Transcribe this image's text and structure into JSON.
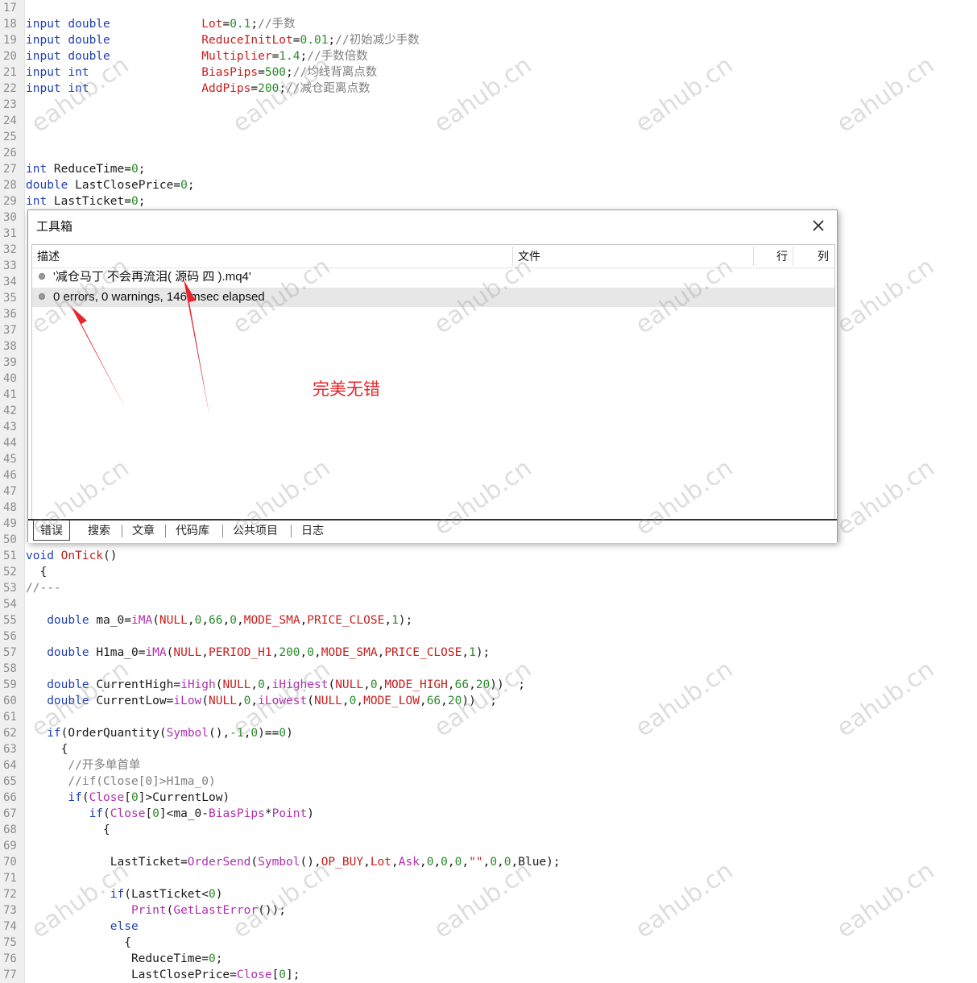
{
  "editor": {
    "lines": [
      {
        "n": "17",
        "t": []
      },
      {
        "n": "18",
        "t": [
          [
            "kw",
            "input double"
          ],
          [
            "tx",
            "             "
          ],
          [
            "cst",
            "Lot"
          ],
          [
            "tx",
            "="
          ],
          [
            "num",
            "0.1"
          ],
          [
            "tx",
            ";"
          ],
          [
            "cm",
            "//手数"
          ]
        ]
      },
      {
        "n": "19",
        "t": [
          [
            "kw",
            "input double"
          ],
          [
            "tx",
            "             "
          ],
          [
            "cst",
            "ReduceInitLot"
          ],
          [
            "tx",
            "="
          ],
          [
            "num",
            "0.01"
          ],
          [
            "tx",
            ";"
          ],
          [
            "cm",
            "//初始减少手数"
          ]
        ]
      },
      {
        "n": "20",
        "t": [
          [
            "kw",
            "input double"
          ],
          [
            "tx",
            "             "
          ],
          [
            "cst",
            "Multiplier"
          ],
          [
            "tx",
            "="
          ],
          [
            "num",
            "1.4"
          ],
          [
            "tx",
            ";"
          ],
          [
            "cm",
            "//手数倍数"
          ]
        ]
      },
      {
        "n": "21",
        "t": [
          [
            "kw",
            "input int"
          ],
          [
            "tx",
            "                "
          ],
          [
            "cst",
            "BiasPips"
          ],
          [
            "tx",
            "="
          ],
          [
            "num",
            "500"
          ],
          [
            "tx",
            ";"
          ],
          [
            "cm",
            "//均线背离点数"
          ]
        ]
      },
      {
        "n": "22",
        "t": [
          [
            "kw",
            "input int"
          ],
          [
            "tx",
            "                "
          ],
          [
            "cst",
            "AddPips"
          ],
          [
            "tx",
            "="
          ],
          [
            "num",
            "200"
          ],
          [
            "tx",
            ";"
          ],
          [
            "cm",
            "//减仓距离点数"
          ]
        ]
      },
      {
        "n": "23",
        "t": []
      },
      {
        "n": "24",
        "t": []
      },
      {
        "n": "25",
        "t": []
      },
      {
        "n": "26",
        "t": []
      },
      {
        "n": "27",
        "t": [
          [
            "kw",
            "int"
          ],
          [
            "tx",
            " ReduceTime="
          ],
          [
            "num",
            "0"
          ],
          [
            "tx",
            ";"
          ]
        ]
      },
      {
        "n": "28",
        "t": [
          [
            "kw",
            "double"
          ],
          [
            "tx",
            " LastClosePrice="
          ],
          [
            "num",
            "0"
          ],
          [
            "tx",
            ";"
          ]
        ]
      },
      {
        "n": "29",
        "t": [
          [
            "kw",
            "int"
          ],
          [
            "tx",
            " LastTicket="
          ],
          [
            "num",
            "0"
          ],
          [
            "tx",
            ";"
          ]
        ]
      },
      {
        "n": "30",
        "t": []
      },
      {
        "n": "31",
        "t": []
      },
      {
        "n": "32",
        "t": []
      },
      {
        "n": "33",
        "t": []
      },
      {
        "n": "34",
        "t": []
      },
      {
        "n": "35",
        "t": []
      },
      {
        "n": "36",
        "t": []
      },
      {
        "n": "37",
        "t": []
      },
      {
        "n": "38",
        "t": []
      },
      {
        "n": "39",
        "t": []
      },
      {
        "n": "40",
        "t": []
      },
      {
        "n": "41",
        "t": []
      },
      {
        "n": "42",
        "t": []
      },
      {
        "n": "43",
        "t": []
      },
      {
        "n": "44",
        "t": []
      },
      {
        "n": "45",
        "t": []
      },
      {
        "n": "46",
        "t": []
      },
      {
        "n": "47",
        "t": []
      },
      {
        "n": "48",
        "t": []
      },
      {
        "n": "49",
        "t": []
      },
      {
        "n": "50",
        "t": []
      },
      {
        "n": "51",
        "t": [
          [
            "kw",
            "void"
          ],
          [
            "tx",
            " "
          ],
          [
            "cst",
            "OnTick"
          ],
          [
            "tx",
            "()"
          ]
        ]
      },
      {
        "n": "52",
        "t": [
          [
            "tx",
            "  {"
          ]
        ]
      },
      {
        "n": "53",
        "t": [
          [
            "cm",
            "//---"
          ]
        ]
      },
      {
        "n": "54",
        "t": []
      },
      {
        "n": "55",
        "t": [
          [
            "tx",
            "   "
          ],
          [
            "kw",
            "double"
          ],
          [
            "tx",
            " ma_0="
          ],
          [
            "fn",
            "iMA"
          ],
          [
            "tx",
            "("
          ],
          [
            "cst",
            "NULL"
          ],
          [
            "tx",
            ","
          ],
          [
            "num",
            "0"
          ],
          [
            "tx",
            ","
          ],
          [
            "num",
            "66"
          ],
          [
            "tx",
            ","
          ],
          [
            "num",
            "0"
          ],
          [
            "tx",
            ","
          ],
          [
            "cst",
            "MODE_SMA"
          ],
          [
            "tx",
            ","
          ],
          [
            "cst",
            "PRICE_CLOSE"
          ],
          [
            "tx",
            ","
          ],
          [
            "num",
            "1"
          ],
          [
            "tx",
            ");"
          ]
        ]
      },
      {
        "n": "56",
        "t": []
      },
      {
        "n": "57",
        "t": [
          [
            "tx",
            "   "
          ],
          [
            "kw",
            "double"
          ],
          [
            "tx",
            " H1ma_0="
          ],
          [
            "fn",
            "iMA"
          ],
          [
            "tx",
            "("
          ],
          [
            "cst",
            "NULL"
          ],
          [
            "tx",
            ","
          ],
          [
            "cst",
            "PERIOD_H1"
          ],
          [
            "tx",
            ","
          ],
          [
            "num",
            "200"
          ],
          [
            "tx",
            ","
          ],
          [
            "num",
            "0"
          ],
          [
            "tx",
            ","
          ],
          [
            "cst",
            "MODE_SMA"
          ],
          [
            "tx",
            ","
          ],
          [
            "cst",
            "PRICE_CLOSE"
          ],
          [
            "tx",
            ","
          ],
          [
            "num",
            "1"
          ],
          [
            "tx",
            ");"
          ]
        ]
      },
      {
        "n": "58",
        "t": []
      },
      {
        "n": "59",
        "t": [
          [
            "tx",
            "   "
          ],
          [
            "kw",
            "double"
          ],
          [
            "tx",
            " CurrentHigh="
          ],
          [
            "fn",
            "iHigh"
          ],
          [
            "tx",
            "("
          ],
          [
            "cst",
            "NULL"
          ],
          [
            "tx",
            ","
          ],
          [
            "num",
            "0"
          ],
          [
            "tx",
            ","
          ],
          [
            "fn",
            "iHighest"
          ],
          [
            "tx",
            "("
          ],
          [
            "cst",
            "NULL"
          ],
          [
            "tx",
            ","
          ],
          [
            "num",
            "0"
          ],
          [
            "tx",
            ","
          ],
          [
            "cst",
            "MODE_HIGH"
          ],
          [
            "tx",
            ","
          ],
          [
            "num",
            "66"
          ],
          [
            "tx",
            ","
          ],
          [
            "num",
            "20"
          ],
          [
            "tx",
            "))  ;"
          ]
        ]
      },
      {
        "n": "60",
        "t": [
          [
            "tx",
            "   "
          ],
          [
            "kw",
            "double"
          ],
          [
            "tx",
            " CurrentLow="
          ],
          [
            "fn",
            "iLow"
          ],
          [
            "tx",
            "("
          ],
          [
            "cst",
            "NULL"
          ],
          [
            "tx",
            ","
          ],
          [
            "num",
            "0"
          ],
          [
            "tx",
            ","
          ],
          [
            "fn",
            "iLowest"
          ],
          [
            "tx",
            "("
          ],
          [
            "cst",
            "NULL"
          ],
          [
            "tx",
            ","
          ],
          [
            "num",
            "0"
          ],
          [
            "tx",
            ","
          ],
          [
            "cst",
            "MODE_LOW"
          ],
          [
            "tx",
            ","
          ],
          [
            "num",
            "66"
          ],
          [
            "tx",
            ","
          ],
          [
            "num",
            "20"
          ],
          [
            "tx",
            "))  ;"
          ]
        ]
      },
      {
        "n": "61",
        "t": []
      },
      {
        "n": "62",
        "t": [
          [
            "tx",
            "   "
          ],
          [
            "kw",
            "if"
          ],
          [
            "tx",
            "(OrderQuantity("
          ],
          [
            "fn",
            "Symbol"
          ],
          [
            "tx",
            "(),"
          ],
          [
            "num",
            "-1"
          ],
          [
            "tx",
            ","
          ],
          [
            "num",
            "0"
          ],
          [
            "tx",
            ")=="
          ],
          [
            "num",
            "0"
          ],
          [
            "tx",
            ")"
          ]
        ]
      },
      {
        "n": "63",
        "t": [
          [
            "tx",
            "     {"
          ]
        ]
      },
      {
        "n": "64",
        "t": [
          [
            "tx",
            "      "
          ],
          [
            "cm",
            "//开多单首单"
          ]
        ]
      },
      {
        "n": "65",
        "t": [
          [
            "tx",
            "      "
          ],
          [
            "cm",
            "//if(Close[0]>H1ma_0)"
          ]
        ]
      },
      {
        "n": "66",
        "t": [
          [
            "tx",
            "      "
          ],
          [
            "kw",
            "if"
          ],
          [
            "tx",
            "("
          ],
          [
            "fn",
            "Close"
          ],
          [
            "tx",
            "["
          ],
          [
            "num",
            "0"
          ],
          [
            "tx",
            "]>CurrentLow)"
          ]
        ]
      },
      {
        "n": "67",
        "t": [
          [
            "tx",
            "         "
          ],
          [
            "kw",
            "if"
          ],
          [
            "tx",
            "("
          ],
          [
            "fn",
            "Close"
          ],
          [
            "tx",
            "["
          ],
          [
            "num",
            "0"
          ],
          [
            "tx",
            "]<ma_0-"
          ],
          [
            "fn",
            "BiasPips"
          ],
          [
            "tx",
            "*"
          ],
          [
            "fn",
            "Point"
          ],
          [
            "tx",
            ")"
          ]
        ]
      },
      {
        "n": "68",
        "t": [
          [
            "tx",
            "           {"
          ]
        ]
      },
      {
        "n": "69",
        "t": []
      },
      {
        "n": "70",
        "t": [
          [
            "tx",
            "            LastTicket="
          ],
          [
            "fn",
            "OrderSend"
          ],
          [
            "tx",
            "("
          ],
          [
            "fn",
            "Symbol"
          ],
          [
            "tx",
            "(),"
          ],
          [
            "cst",
            "OP_BUY"
          ],
          [
            "tx",
            ","
          ],
          [
            "cst",
            "Lot"
          ],
          [
            "tx",
            ","
          ],
          [
            "fn",
            "Ask"
          ],
          [
            "tx",
            ","
          ],
          [
            "num",
            "0"
          ],
          [
            "tx",
            ","
          ],
          [
            "num",
            "0"
          ],
          [
            "tx",
            ","
          ],
          [
            "num",
            "0"
          ],
          [
            "tx",
            ","
          ],
          [
            "cst",
            "\"\""
          ],
          [
            "tx",
            ","
          ],
          [
            "num",
            "0"
          ],
          [
            "tx",
            ","
          ],
          [
            "num",
            "0"
          ],
          [
            "tx",
            ",Blue);"
          ]
        ]
      },
      {
        "n": "71",
        "t": []
      },
      {
        "n": "72",
        "t": [
          [
            "tx",
            "            "
          ],
          [
            "kw",
            "if"
          ],
          [
            "tx",
            "(LastTicket<"
          ],
          [
            "num",
            "0"
          ],
          [
            "tx",
            ")"
          ]
        ]
      },
      {
        "n": "73",
        "t": [
          [
            "tx",
            "               "
          ],
          [
            "fn",
            "Print"
          ],
          [
            "tx",
            "("
          ],
          [
            "fn",
            "GetLastError"
          ],
          [
            "tx",
            "());"
          ]
        ]
      },
      {
        "n": "74",
        "t": [
          [
            "tx",
            "            "
          ],
          [
            "kw",
            "else"
          ]
        ]
      },
      {
        "n": "75",
        "t": [
          [
            "tx",
            "              {"
          ]
        ]
      },
      {
        "n": "76",
        "t": [
          [
            "tx",
            "               ReduceTime="
          ],
          [
            "num",
            "0"
          ],
          [
            "tx",
            ";"
          ]
        ]
      },
      {
        "n": "77",
        "t": [
          [
            "tx",
            "               LastClosePrice="
          ],
          [
            "fn",
            "Close"
          ],
          [
            "tx",
            "["
          ],
          [
            "num",
            "0"
          ],
          [
            "tx",
            "];"
          ]
        ]
      }
    ]
  },
  "toolbox": {
    "title": "工具箱",
    "columns": {
      "description": "描述",
      "file": "文件",
      "row": "行",
      "col": "列"
    },
    "rows": [
      {
        "text": "'减仓马丁 不会再流泪( 源码 四 ).mq4'",
        "selected": false
      },
      {
        "text": "0 errors, 0 warnings, 146 msec elapsed",
        "selected": true
      }
    ],
    "tabs": [
      "错误",
      "搜索",
      "文章",
      "代码库",
      "公共项目",
      "日志"
    ],
    "active_tab": "错误"
  },
  "annotation": {
    "text": "完美无错",
    "color": "#e8252a"
  },
  "watermark": {
    "text": "eahub.cn"
  },
  "colors": {
    "keyword": "#1f3fb4",
    "function": "#b02fb0",
    "number": "#2a8a2a",
    "constant": "#c81e1e",
    "comment": "#808080"
  }
}
